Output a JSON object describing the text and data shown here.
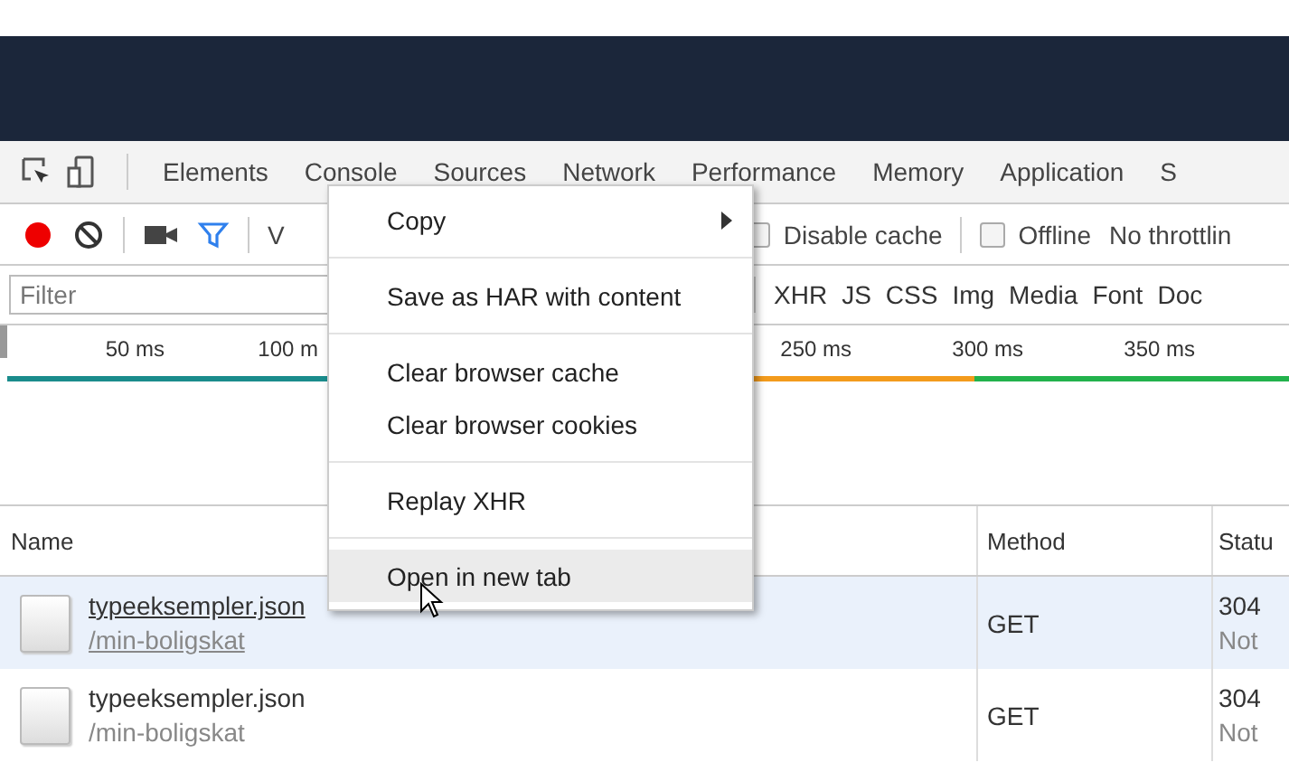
{
  "tabs": [
    {
      "label": "Elements",
      "selected": false
    },
    {
      "label": "Console",
      "selected": false
    },
    {
      "label": "Sources",
      "selected": false
    },
    {
      "label": "Network",
      "selected": false
    },
    {
      "label": "Performance",
      "selected": false
    },
    {
      "label": "Memory",
      "selected": false
    },
    {
      "label": "Application",
      "selected": false
    },
    {
      "label": "S",
      "selected": false
    }
  ],
  "toolbar": {
    "recording": true,
    "filter_active": true,
    "view_label": "V",
    "checkboxes": [
      {
        "label": "Disable cache",
        "checked": false
      },
      {
        "label": "Offline",
        "checked": false
      }
    ],
    "throttling": "No throttlin"
  },
  "filter": {
    "placeholder": "Filter",
    "types": [
      "XHR",
      "JS",
      "CSS",
      "Img",
      "Media",
      "Font",
      "Doc"
    ]
  },
  "timeline": {
    "ticks": [
      "50 ms",
      "100 m",
      "250 ms",
      "300 ms",
      "350 ms"
    ]
  },
  "table": {
    "columns": [
      "Name",
      "Method",
      "Statu"
    ],
    "rows": [
      {
        "name": "typeeksempler.json",
        "path": "/min-boligskat",
        "method": "GET",
        "status": "304",
        "status_text": "Not",
        "selected": true,
        "hovered": true
      },
      {
        "name": "typeeksempler.json",
        "path": "/min-boligskat",
        "method": "GET",
        "status": "304",
        "status_text": "Not",
        "selected": false,
        "hovered": false
      }
    ]
  },
  "menu": {
    "groups": [
      [
        {
          "label": "Copy",
          "has_submenu": true,
          "highlighted": false
        }
      ],
      [
        {
          "label": "Save as HAR with content",
          "has_submenu": false,
          "highlighted": false
        }
      ],
      [
        {
          "label": "Clear browser cache",
          "has_submenu": false,
          "highlighted": false
        },
        {
          "label": "Clear browser cookies",
          "has_submenu": false,
          "highlighted": false
        }
      ],
      [
        {
          "label": "Replay XHR",
          "has_submenu": false,
          "highlighted": false
        }
      ],
      [
        {
          "label": "Open in new tab",
          "has_submenu": false,
          "highlighted": true
        }
      ]
    ]
  }
}
